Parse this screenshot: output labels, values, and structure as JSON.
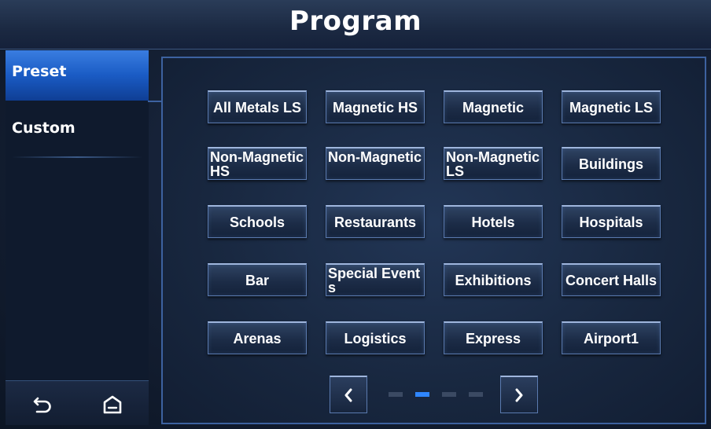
{
  "header": {
    "title": "Program"
  },
  "sidebar": {
    "items": [
      {
        "label": "Preset",
        "active": true
      },
      {
        "label": "Custom",
        "active": false
      }
    ],
    "bottom_icons": [
      "back-icon",
      "home-icon"
    ]
  },
  "programs": [
    "All Metals LS",
    "Magnetic HS",
    "Magnetic",
    "Magnetic LS",
    "Non-Magnetic HS",
    "Non-Magnetic",
    "Non-Magnetic LS",
    "Buildings",
    "Schools",
    "Restaurants",
    "Hotels",
    "Hospitals",
    "Bar",
    "Special Events",
    "Exhibitions",
    "Concert Halls",
    "Arenas",
    "Logistics",
    "Express",
    "Airport1"
  ],
  "pager": {
    "current_page": 2,
    "total_pages": 4,
    "prev_icon": "chevron-left-icon",
    "next_icon": "chevron-right-icon"
  },
  "colors": {
    "accent": "#2f86ff",
    "active_tab": "#1a5bc4",
    "panel_border": "#3d62a0"
  }
}
